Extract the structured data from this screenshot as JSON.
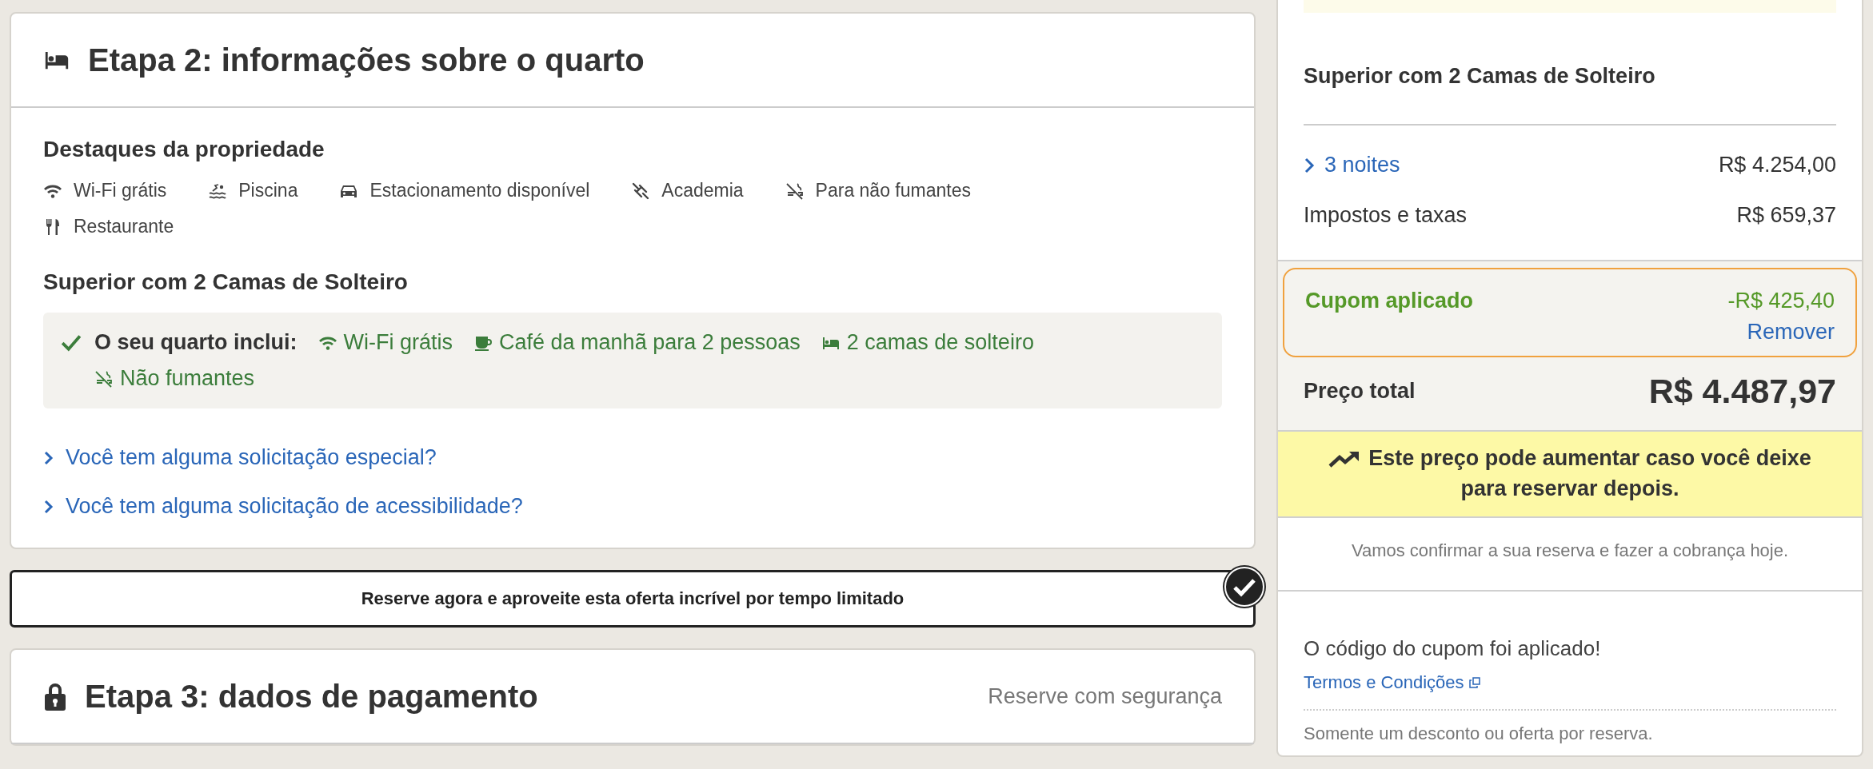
{
  "step2": {
    "title": "Etapa 2: informações sobre o quarto",
    "highlights_heading": "Destaques da propriedade",
    "highlights": [
      {
        "kind": "wifi",
        "label": "Wi-Fi grátis"
      },
      {
        "kind": "pool",
        "label": "Piscina"
      },
      {
        "kind": "car",
        "label": "Estacionamento disponível"
      },
      {
        "kind": "gym",
        "label": "Academia"
      },
      {
        "kind": "nosmoking",
        "label": "Para não fumantes"
      },
      {
        "kind": "restaurant",
        "label": "Restaurante"
      }
    ],
    "room_name": "Superior com 2 Camas de Solteiro",
    "includes": {
      "label": "O seu quarto inclui:",
      "items": [
        {
          "kind": "wifi",
          "label": "Wi-Fi grátis"
        },
        {
          "kind": "coffee",
          "label": "Café da manhã para 2 pessoas"
        },
        {
          "kind": "bed",
          "label": "2 camas de solteiro"
        },
        {
          "kind": "nosmoking",
          "label": "Não fumantes"
        }
      ]
    },
    "links": [
      "Você tem alguma solicitação especial?",
      "Você tem alguma solicitação de acessibilidade?"
    ]
  },
  "offer_banner": {
    "text": "Reserve agora e aproveite esta oferta incrível por tempo limitado",
    "checked": true
  },
  "step3": {
    "title": "Etapa 3: dados de pagamento",
    "secure_label": "Reserve com segurança"
  },
  "summary": {
    "room_name": "Superior com 2 Camas de Solteiro",
    "lines": [
      {
        "kind": "expandable",
        "label": "3 noites",
        "amount": "R$ 4.254,00"
      },
      {
        "kind": "plain",
        "label": "Impostos e taxas",
        "amount": "R$ 659,37"
      }
    ],
    "coupon": {
      "label": "Cupom aplicado",
      "amount": "-R$ 425,40",
      "action": "Remover"
    },
    "total": {
      "label": "Preço total",
      "amount": "R$ 4.487,97"
    },
    "price_alert": "Este preço pode aumentar caso você deixe para reservar depois.",
    "charge_note": "Vamos confirmar a sua reserva e fazer a cobrança hoje.",
    "coupon_message": "O código do cupom foi aplicado!",
    "terms_link": "Termos e Condições",
    "restriction_note": "Somente um desconto ou oferta por reserva."
  }
}
